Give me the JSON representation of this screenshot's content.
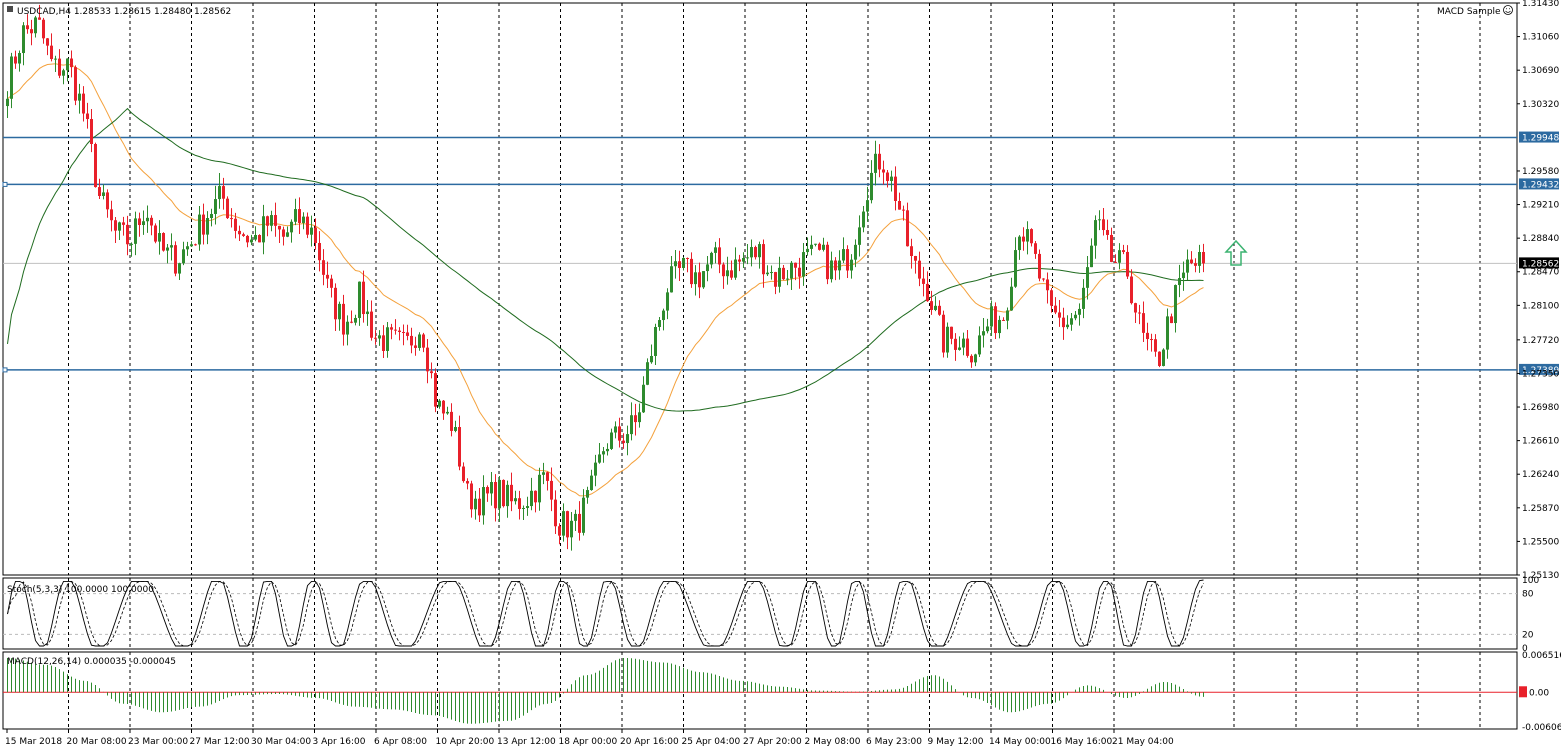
{
  "header": {
    "symbol_info": "USDCAD,H4  1.28533 1.28615 1.28480 1.28562",
    "expert_label": "MACD Sample",
    "expert_icon": "smiley-face-icon"
  },
  "colors": {
    "up_candle": "#2e8b2e",
    "down_candle": "#e8202a",
    "ma_fast": "#f4a13c",
    "ma_slow": "#1f6b1f",
    "level_line": "#2c6aa0",
    "price_line": "#c0c0c0",
    "arrow": "#3cb371",
    "macd_hist": "#2e8b2e",
    "macd_signal": "#e8202a"
  },
  "chart_data": [
    {
      "type": "candlestick",
      "name": "price",
      "ylim": [
        1.2513,
        1.3143
      ],
      "y_ticks": [
        "1.31430",
        "1.31060",
        "1.30690",
        "1.30320",
        "1.29580",
        "1.29210",
        "1.28840",
        "1.28470",
        "1.28100",
        "1.27720",
        "1.27350",
        "1.26980",
        "1.26610",
        "1.26240",
        "1.25870",
        "1.25500",
        "1.25130"
      ],
      "x_ticks": [
        "15 Mar 2018",
        "20 Mar 08:00",
        "23 Mar 00:00",
        "27 Mar 12:00",
        "30 Mar 04:00",
        "3 Apr 16:00",
        "6 Apr 08:00",
        "10 Apr 20:00",
        "13 Apr 12:00",
        "18 Apr 00:00",
        "20 Apr 16:00",
        "25 Apr 04:00",
        "27 Apr 20:00",
        "2 May 08:00",
        "6 May 23:00",
        "9 May 12:00",
        "14 May 00:00",
        "16 May 16:00",
        "21 May 04:00"
      ],
      "anchors_close": [
        1.3055,
        1.311,
        1.312,
        1.307,
        1.3075,
        1.302,
        1.293,
        1.289,
        1.288,
        1.292,
        1.287,
        1.286,
        1.288,
        1.291,
        1.293,
        1.2895,
        1.288,
        1.29,
        1.2885,
        1.2905,
        1.289,
        1.282,
        1.279,
        1.282,
        1.2775,
        1.277,
        1.2765,
        1.279,
        1.27,
        1.268,
        1.26,
        1.2595,
        1.2605,
        1.259,
        1.26,
        1.262,
        1.257,
        1.2565,
        1.26,
        1.266,
        1.2665,
        1.268,
        1.276,
        1.283,
        1.285,
        1.284,
        1.286,
        1.285,
        1.286,
        1.287,
        1.284,
        1.285,
        1.286,
        1.2865,
        1.2845,
        1.287,
        1.294,
        1.2975,
        1.293,
        1.2855,
        1.283,
        1.277,
        1.2775,
        1.276,
        1.279,
        1.28,
        1.29,
        1.286,
        1.28,
        1.279,
        1.2805,
        1.29,
        1.286,
        1.285,
        1.2775,
        1.2745,
        1.281,
        1.2855,
        1.2856
      ],
      "support_resistance": [
        1.29948,
        1.29432,
        1.27389
      ],
      "level_labels": [
        "1.29948",
        "1.29432",
        "1.27389"
      ],
      "current_price": 1.28562,
      "current_price_label": "1.28562",
      "moving_averages": [
        "fast (50)",
        "slow (200)"
      ]
    },
    {
      "type": "line",
      "name": "stochastic",
      "label": "Stoch(5,3,3) 100.0000 100.0000",
      "ylim": [
        0,
        100
      ],
      "y_ticks": [
        "100",
        "80",
        "20",
        "0"
      ],
      "levels": [
        80,
        20
      ]
    },
    {
      "type": "bar",
      "name": "macd",
      "label": "MACD(12,26,14) 0.000035 -0.000045",
      "ylim": [
        -0.006067,
        0.006516
      ],
      "y_ticks": [
        "0.006516",
        "0.00",
        "-0.006067"
      ],
      "current_value_label": "0.00",
      "histogram_anchors": [
        0.006,
        0.0048,
        0.002,
        -0.002,
        -0.0035,
        -0.0025,
        -0.0005,
        -0.0003,
        -0.001,
        -0.0025,
        -0.003,
        -0.004,
        -0.0055,
        -0.005,
        -0.002,
        0.003,
        0.006,
        0.0052,
        0.0035,
        0.002,
        0.001,
        0.0003,
        0.0001,
        0.0005,
        0.003,
        -0.001,
        -0.0035,
        -0.002,
        0.0012,
        -0.001,
        0.0018,
        -0.0008
      ]
    }
  ]
}
